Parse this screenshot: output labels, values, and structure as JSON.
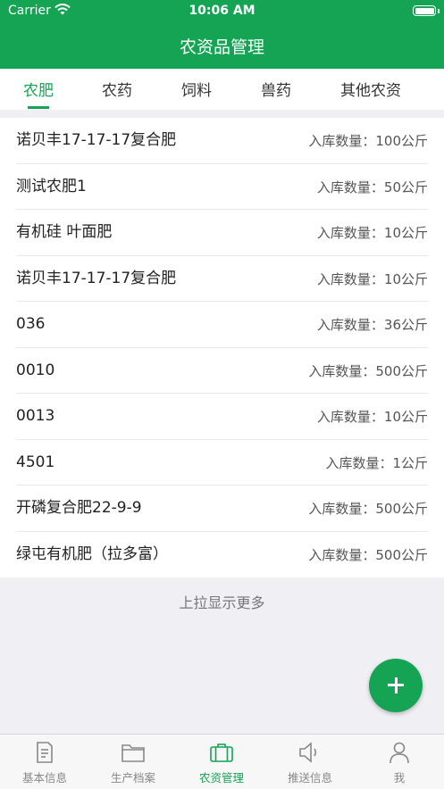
{
  "status_bar": {
    "carrier": "Carrier",
    "time": "10:06 AM"
  },
  "header": {
    "title": "农资品管理"
  },
  "tabs": [
    {
      "label": "农肥",
      "active": true
    },
    {
      "label": "农药",
      "active": false
    },
    {
      "label": "饲料",
      "active": false
    },
    {
      "label": "兽药",
      "active": false
    },
    {
      "label": "其他农资",
      "active": false
    }
  ],
  "items": [
    {
      "name": "诺贝丰17-17-17复合肥",
      "qty": "入库数量：100公斤"
    },
    {
      "name": "测试农肥1",
      "qty": "入库数量：50公斤"
    },
    {
      "name": "有机硅 叶面肥",
      "qty": "入库数量：10公斤"
    },
    {
      "name": "诺贝丰17-17-17复合肥",
      "qty": "入库数量：10公斤"
    },
    {
      "name": "036",
      "qty": "入库数量：36公斤"
    },
    {
      "name": "0010",
      "qty": "入库数量：500公斤"
    },
    {
      "name": "0013",
      "qty": "入库数量：10公斤"
    },
    {
      "name": "4501",
      "qty": "入库数量：1公斤"
    },
    {
      "name": "开磷复合肥22-9-9",
      "qty": "入库数量：500公斤"
    },
    {
      "name": "绿屯有机肥（拉多富）",
      "qty": "入库数量：500公斤"
    }
  ],
  "load_more": "上拉显示更多",
  "fab": {
    "icon": "plus-icon"
  },
  "tabbar": [
    {
      "label": "基本信息",
      "icon": "document-icon",
      "active": false
    },
    {
      "label": "生产档案",
      "icon": "folder-icon",
      "active": false
    },
    {
      "label": "农资管理",
      "icon": "briefcase-icon",
      "active": true
    },
    {
      "label": "推送信息",
      "icon": "speaker-icon",
      "active": false
    },
    {
      "label": "我",
      "icon": "person-icon",
      "active": false
    }
  ],
  "colors": {
    "primary": "#14a454",
    "background": "#efeff4",
    "inactive": "#888888"
  }
}
